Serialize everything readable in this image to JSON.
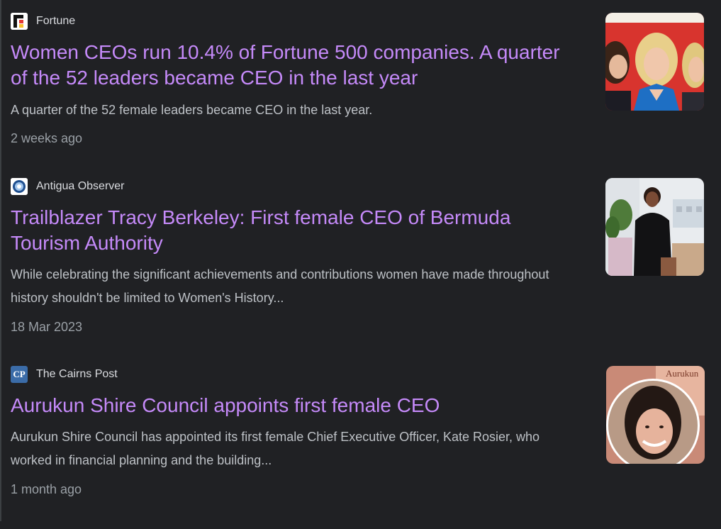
{
  "results": [
    {
      "source": "Fortune",
      "headline": "Women CEOs run 10.4% of Fortune 500 companies. A quarter of the 52 leaders became CEO in the last year",
      "snippet": "A quarter of the 52 female leaders became CEO in the last year.",
      "date": "2 weeks ago",
      "favicon": "fortune-logo-icon"
    },
    {
      "source": "Antigua Observer",
      "headline": "Trailblazer Tracy Berkeley: First female CEO of Bermuda Tourism Authority",
      "snippet": "While celebrating the significant achievements and contributions women have made throughout history shouldn't be limited to Women's History...",
      "date": "18 Mar 2023",
      "favicon": "antigua-observer-logo-icon"
    },
    {
      "source": "The Cairns Post",
      "headline": "Aurukun Shire Council appoints first female CEO",
      "snippet": "Aurukun Shire Council has appointed its first female Chief Executive Officer, Kate Rosier, who worked in financial planning and the building...",
      "date": "1 month ago",
      "favicon": "cairns-post-logo-icon",
      "favicon_text": "CP",
      "thumbnail_text": "Aurukun"
    }
  ],
  "colors": {
    "background": "#202124",
    "headline": "#c58af9",
    "snippet": "#bdc1c6",
    "date": "#9aa0a6",
    "source": "#dadce0"
  }
}
